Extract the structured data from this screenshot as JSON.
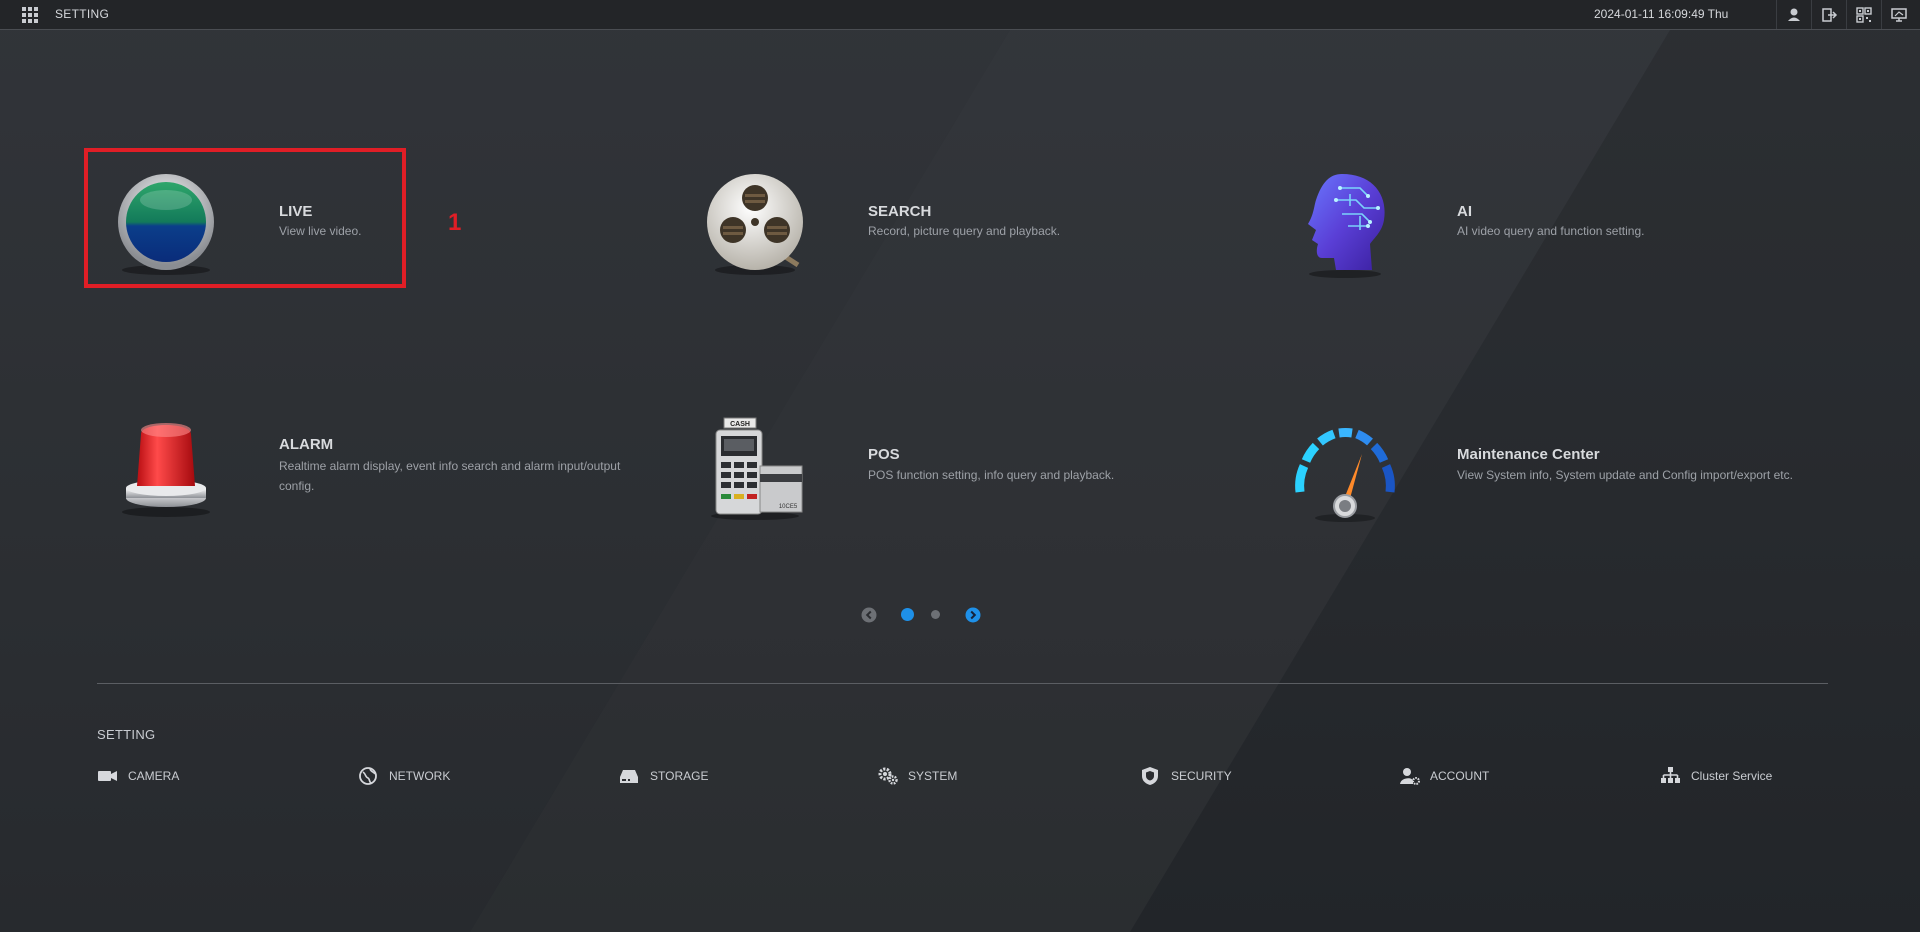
{
  "topbar": {
    "title": "SETTING",
    "datetime": "2024-01-11 16:09:49 Thu",
    "icons": [
      "user-icon",
      "logout-icon",
      "qr-code-icon",
      "monitor-icon"
    ]
  },
  "tiles": [
    {
      "title": "LIVE",
      "desc": "View live video."
    },
    {
      "title": "SEARCH",
      "desc": "Record, picture query and playback."
    },
    {
      "title": "AI",
      "desc": "AI video query and function setting."
    },
    {
      "title": "ALARM",
      "desc": "Realtime alarm display, event info search and alarm input/output config."
    },
    {
      "title": "POS",
      "desc": "POS function setting, info query and playback."
    },
    {
      "title": "Maintenance Center",
      "desc": "View System info, System update and Config import/export etc."
    }
  ],
  "annotation": {
    "number": "1",
    "color": "#e01e26"
  },
  "pager": {
    "current_page": 1,
    "total_pages": 2,
    "active_color": "#1e90e8"
  },
  "pos_labels": {
    "cash": "CASH",
    "card": "10CE5"
  },
  "settings": {
    "label": "SETTING",
    "items": [
      {
        "label": "CAMERA",
        "icon": "camera-icon"
      },
      {
        "label": "NETWORK",
        "icon": "network-globe-icon"
      },
      {
        "label": "STORAGE",
        "icon": "storage-drive-icon"
      },
      {
        "label": "SYSTEM",
        "icon": "gears-icon"
      },
      {
        "label": "SECURITY",
        "icon": "shield-icon"
      },
      {
        "label": "ACCOUNT",
        "icon": "user-settings-icon"
      },
      {
        "label": "Cluster Service",
        "icon": "cluster-tree-icon"
      }
    ]
  }
}
